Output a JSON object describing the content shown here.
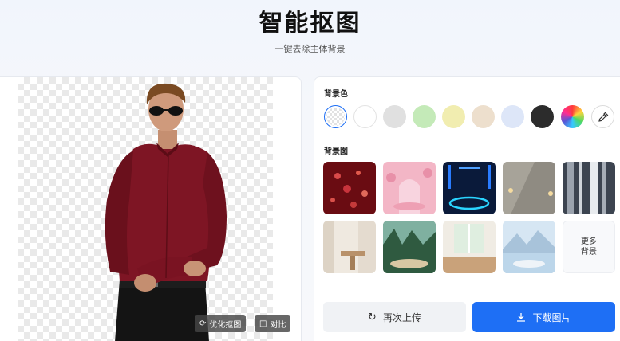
{
  "header": {
    "title": "智能抠图",
    "subtitle": "一键去除主体背景"
  },
  "preview": {
    "optimize_label": "优化抠图",
    "compare_label": "对比"
  },
  "panel": {
    "bg_color_title": "背景色",
    "bg_image_title": "背景图",
    "colors": [
      "transparent",
      "#ffffff",
      "#e0e0e0",
      "#c4eab8",
      "#f1edb0",
      "#eddfcd",
      "#dde6f8",
      "#2c2c2c",
      "rainbow",
      "picker"
    ],
    "backgrounds": [
      "red-hearts",
      "pink-arch-room",
      "blue-neon-stage",
      "gray-wall-lamp",
      "metal-stripes",
      "curtain-table",
      "forest-podium",
      "window-table",
      "mountain-lake-podium"
    ],
    "more_line1": "更多",
    "more_line2": "背景",
    "reupload_label": "再次上传",
    "download_label": "下载图片"
  }
}
